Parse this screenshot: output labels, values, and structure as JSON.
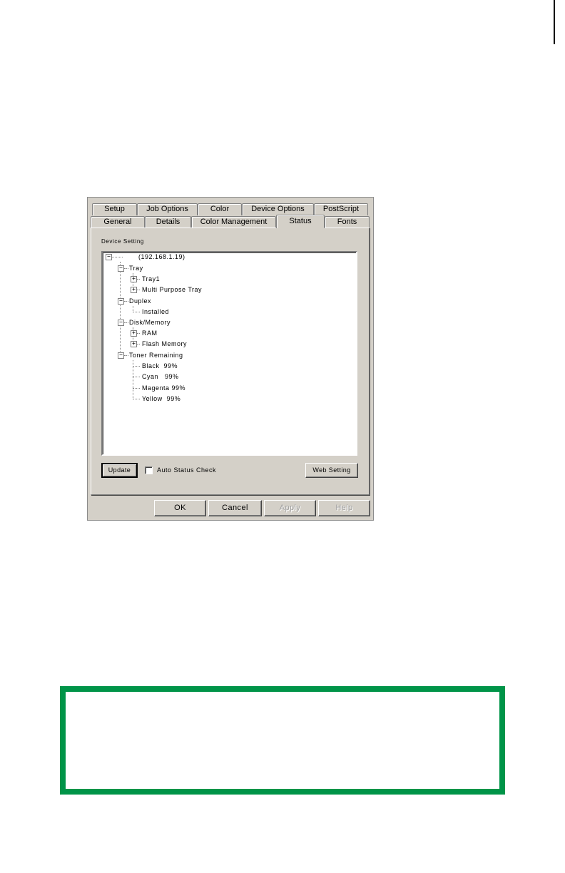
{
  "tabs_back_row": [
    {
      "label": "Setup"
    },
    {
      "label": "Job Options"
    },
    {
      "label": "Color"
    },
    {
      "label": "Device Options"
    },
    {
      "label": "PostScript"
    }
  ],
  "tabs_front_row": [
    {
      "label": "General"
    },
    {
      "label": "Details"
    },
    {
      "label": "Color Management"
    },
    {
      "label": "Status"
    },
    {
      "label": "Fonts"
    }
  ],
  "status_panel": {
    "group_label": "Device Setting",
    "tree": {
      "root": "(192.168.1.19)",
      "tray": "Tray",
      "tray1": "Tray1",
      "multi_purpose_tray": "Multi Purpose Tray",
      "duplex": "Duplex",
      "installed": "Installed",
      "disk_memory": "Disk/Memory",
      "ram": "RAM",
      "flash_memory": "Flash Memory",
      "toner_remaining": "Toner Remaining",
      "black": "Black  99%",
      "cyan": "Cyan   99%",
      "magenta": "Magenta 99%",
      "yellow": "Yellow  99%"
    },
    "update_label": "Update",
    "auto_status_label": "Auto Status Check",
    "auto_status_checked": false,
    "web_setting_label": "Web Setting"
  },
  "dialog_buttons": {
    "ok": "OK",
    "cancel": "Cancel",
    "apply": "Apply",
    "help": "Help"
  },
  "colors": {
    "note_border": "#009448",
    "dialog_face": "#d4d0c8"
  }
}
